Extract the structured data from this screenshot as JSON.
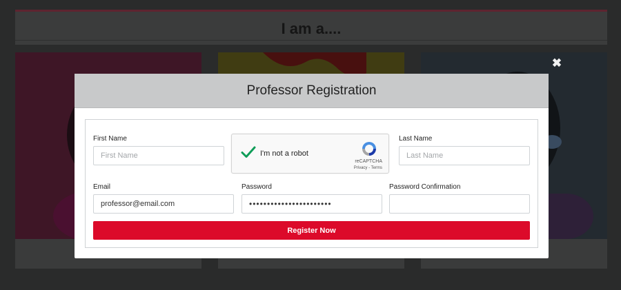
{
  "page": {
    "heading": "I am a...."
  },
  "modal": {
    "close_icon": "close-icon",
    "title": "Professor Registration",
    "form": {
      "first_name": {
        "label": "First Name",
        "value": "",
        "placeholder": "First Name"
      },
      "last_name": {
        "label": "Last Name",
        "value": "",
        "placeholder": "Last Name"
      },
      "email": {
        "label": "Email",
        "value": "professor@email.com",
        "placeholder": ""
      },
      "password": {
        "label": "Password",
        "value": "•••••••••••••••••••••••",
        "placeholder": ""
      },
      "password_confirmation": {
        "label": "Password Confirmation",
        "value": "",
        "placeholder": ""
      },
      "captcha": {
        "label": "I'm not a robot",
        "checked": true,
        "brand": "reCAPTCHA",
        "privacy": "Privacy",
        "separator": " - ",
        "terms": "Terms"
      },
      "submit_label": "Register Now"
    }
  },
  "colors": {
    "overlay_bg": "#2a2b2b",
    "modal_header": "#c8c9ca",
    "submit": "#dc0a2a",
    "check": "#0f9d58"
  },
  "icons": [
    "close-icon",
    "checkmark-icon",
    "recaptcha-logo-icon"
  ]
}
